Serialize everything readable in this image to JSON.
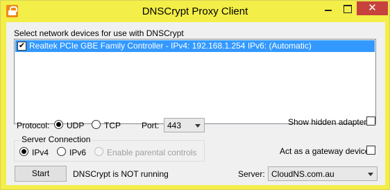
{
  "window": {
    "title": "DNSCrypt Proxy Client",
    "close_glyph": "✕",
    "icon": "lock-app-icon"
  },
  "devices": {
    "heading": "Select network devices for use with DNSCrypt",
    "items": [
      {
        "label": "Realtek PCIe GBE Family Controller - IPv4: 192.168.1.254 IPv6: (Automatic)",
        "checked": true,
        "selected": true
      }
    ],
    "check_glyph": "✔"
  },
  "protocol": {
    "label": "Protocol:",
    "options": [
      {
        "label": "UDP",
        "selected": true
      },
      {
        "label": "TCP",
        "selected": false
      }
    ]
  },
  "port": {
    "label": "Port:",
    "value": "443"
  },
  "show_hidden": {
    "label": "Show hidden adapters",
    "checked": false
  },
  "server_connection": {
    "title": "Server Connection",
    "options": [
      {
        "label": "IPv4",
        "selected": true
      },
      {
        "label": "IPv6",
        "selected": false
      }
    ],
    "parental": {
      "label": "Enable parental controls",
      "selected": false,
      "enabled": false
    }
  },
  "gateway": {
    "label": "Act as a gateway device",
    "checked": false
  },
  "start": {
    "label": "Start"
  },
  "status": {
    "text": "DNSCrypt is NOT running"
  },
  "server": {
    "label": "Server:",
    "value": "CloudNS.com.au"
  },
  "colors": {
    "title_bar": "#f3ee48",
    "close_button": "#c7423c",
    "selection": "#3399ff",
    "app_icon": "#f08a1a"
  }
}
